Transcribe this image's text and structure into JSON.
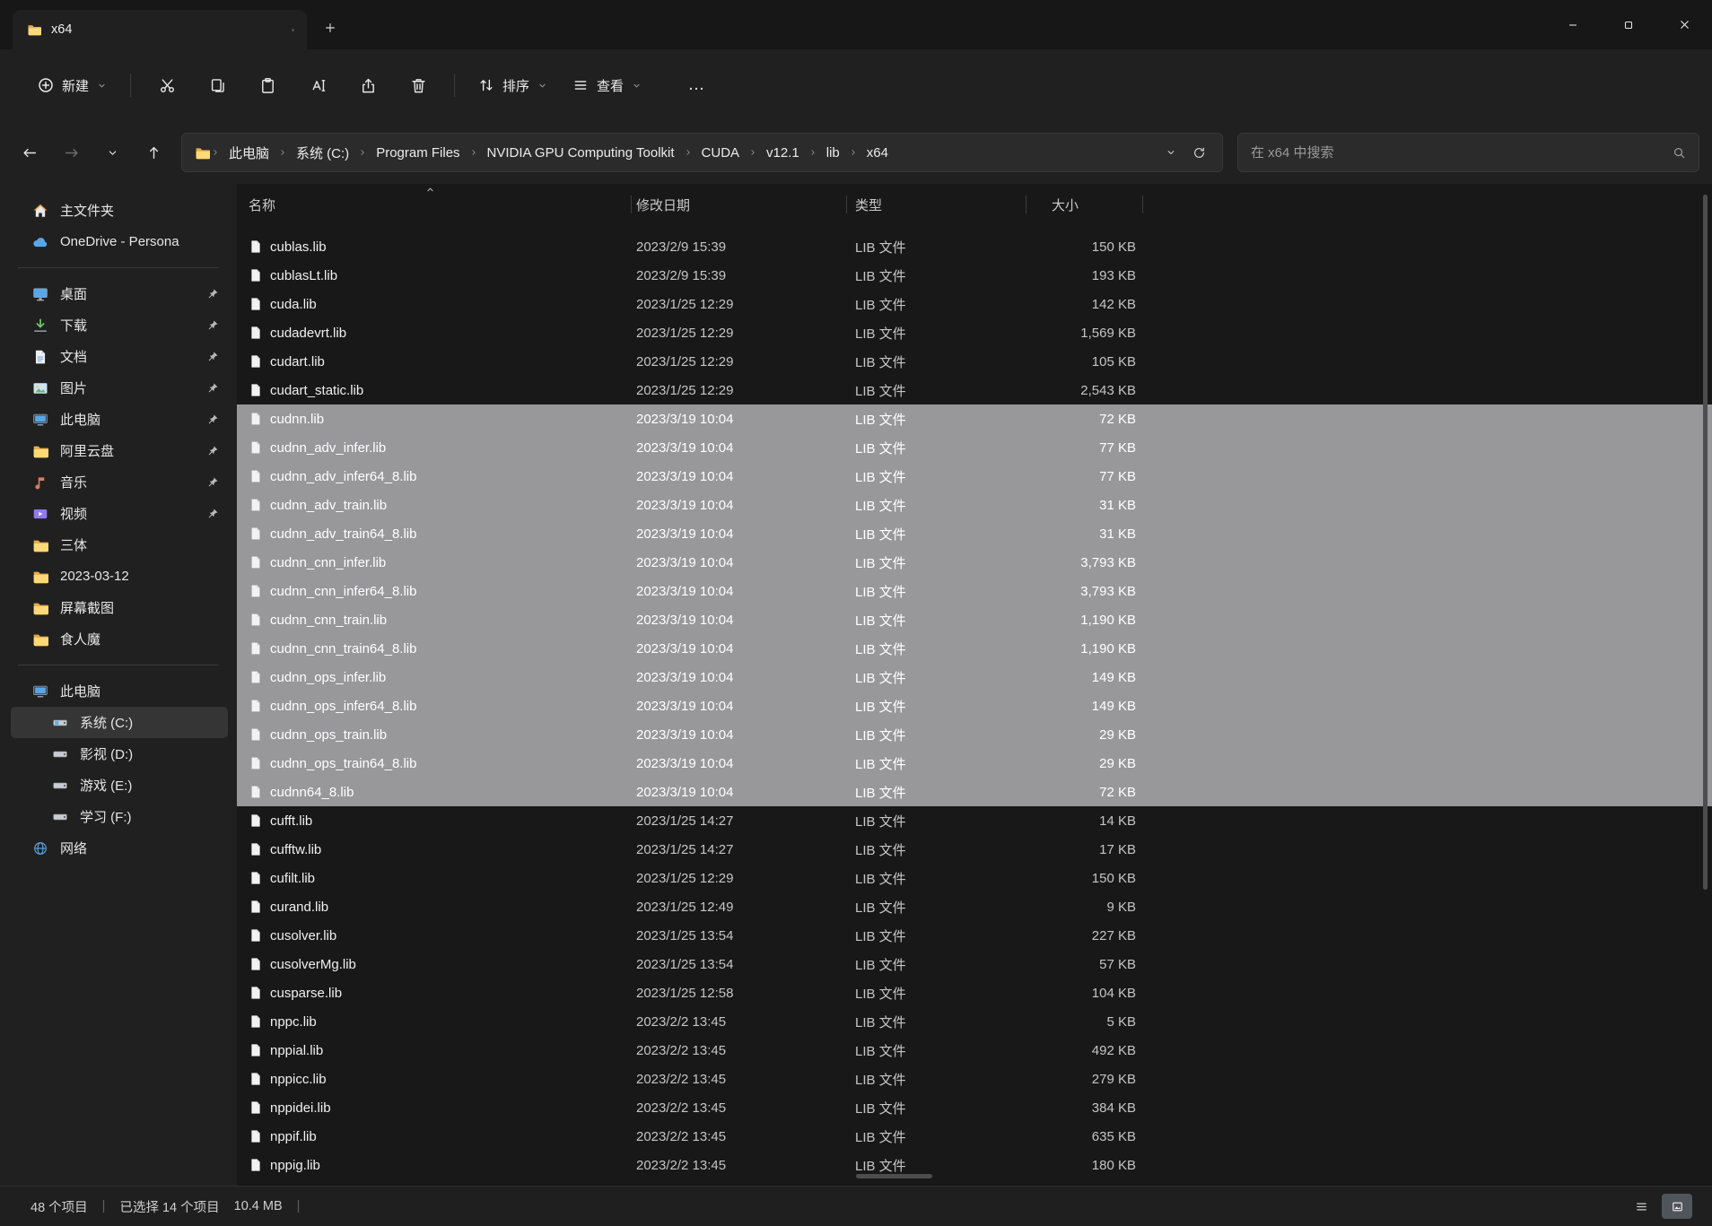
{
  "window": {
    "tab": {
      "title": "x64"
    }
  },
  "toolbar": {
    "new_label": "新建",
    "sort_label": "排序",
    "view_label": "查看",
    "more_label": "…",
    "icon_buttons": [
      {
        "icon": "cut"
      },
      {
        "icon": "copy"
      },
      {
        "icon": "paste"
      },
      {
        "icon": "rename"
      },
      {
        "icon": "share"
      },
      {
        "icon": "trash"
      }
    ]
  },
  "address": {
    "crumbs": [
      {
        "label": "此电脑"
      },
      {
        "label": "系统 (C:)"
      },
      {
        "label": "Program Files"
      },
      {
        "label": "NVIDIA GPU Computing Toolkit"
      },
      {
        "label": "CUDA"
      },
      {
        "label": "v12.1"
      },
      {
        "label": "lib"
      },
      {
        "label": "x64"
      }
    ],
    "search_placeholder": "在 x64 中搜索"
  },
  "sidebar": {
    "top": [
      {
        "label": "主文件夹",
        "icon": "home"
      },
      {
        "label": "OneDrive - Persona",
        "icon": "cloud"
      }
    ],
    "quick": [
      {
        "label": "桌面",
        "icon": "desktop",
        "pinned": true
      },
      {
        "label": "下载",
        "icon": "download",
        "pinned": true
      },
      {
        "label": "文档",
        "icon": "document",
        "pinned": true
      },
      {
        "label": "图片",
        "icon": "picture",
        "pinned": true
      },
      {
        "label": "此电脑",
        "icon": "pc",
        "pinned": true
      },
      {
        "label": "阿里云盘",
        "icon": "folder",
        "pinned": true
      },
      {
        "label": "音乐",
        "icon": "music",
        "pinned": true
      },
      {
        "label": "视频",
        "icon": "video",
        "pinned": true
      },
      {
        "label": "三体",
        "icon": "folder"
      },
      {
        "label": "2023-03-12",
        "icon": "folder"
      },
      {
        "label": "屏幕截图",
        "icon": "folder"
      },
      {
        "label": "食人魔",
        "icon": "folder"
      }
    ],
    "drives": [
      {
        "label": "此电脑",
        "icon": "pc"
      },
      {
        "label": "系统 (C:)",
        "icon": "drive-win",
        "selected": true,
        "indent": true
      },
      {
        "label": "影视 (D:)",
        "icon": "drive",
        "indent": true
      },
      {
        "label": "游戏 (E:)",
        "icon": "drive",
        "indent": true
      },
      {
        "label": "学习 (F:)",
        "icon": "drive",
        "indent": true
      },
      {
        "label": "网络",
        "icon": "network"
      }
    ]
  },
  "filelist": {
    "columns": {
      "name": "名称",
      "date": "修改日期",
      "type": "类型",
      "size": "大小"
    },
    "rows": [
      {
        "name": "cublas.lib",
        "date": "2023/2/9 15:39",
        "type": "LIB 文件",
        "size": "150 KB"
      },
      {
        "name": "cublasLt.lib",
        "date": "2023/2/9 15:39",
        "type": "LIB 文件",
        "size": "193 KB"
      },
      {
        "name": "cuda.lib",
        "date": "2023/1/25 12:29",
        "type": "LIB 文件",
        "size": "142 KB"
      },
      {
        "name": "cudadevrt.lib",
        "date": "2023/1/25 12:29",
        "type": "LIB 文件",
        "size": "1,569 KB"
      },
      {
        "name": "cudart.lib",
        "date": "2023/1/25 12:29",
        "type": "LIB 文件",
        "size": "105 KB"
      },
      {
        "name": "cudart_static.lib",
        "date": "2023/1/25 12:29",
        "type": "LIB 文件",
        "size": "2,543 KB"
      },
      {
        "name": "cudnn.lib",
        "date": "2023/3/19 10:04",
        "type": "LIB 文件",
        "size": "72 KB",
        "selected": true
      },
      {
        "name": "cudnn_adv_infer.lib",
        "date": "2023/3/19 10:04",
        "type": "LIB 文件",
        "size": "77 KB",
        "selected": true
      },
      {
        "name": "cudnn_adv_infer64_8.lib",
        "date": "2023/3/19 10:04",
        "type": "LIB 文件",
        "size": "77 KB",
        "selected": true
      },
      {
        "name": "cudnn_adv_train.lib",
        "date": "2023/3/19 10:04",
        "type": "LIB 文件",
        "size": "31 KB",
        "selected": true
      },
      {
        "name": "cudnn_adv_train64_8.lib",
        "date": "2023/3/19 10:04",
        "type": "LIB 文件",
        "size": "31 KB",
        "selected": true
      },
      {
        "name": "cudnn_cnn_infer.lib",
        "date": "2023/3/19 10:04",
        "type": "LIB 文件",
        "size": "3,793 KB",
        "selected": true
      },
      {
        "name": "cudnn_cnn_infer64_8.lib",
        "date": "2023/3/19 10:04",
        "type": "LIB 文件",
        "size": "3,793 KB",
        "selected": true
      },
      {
        "name": "cudnn_cnn_train.lib",
        "date": "2023/3/19 10:04",
        "type": "LIB 文件",
        "size": "1,190 KB",
        "selected": true
      },
      {
        "name": "cudnn_cnn_train64_8.lib",
        "date": "2023/3/19 10:04",
        "type": "LIB 文件",
        "size": "1,190 KB",
        "selected": true
      },
      {
        "name": "cudnn_ops_infer.lib",
        "date": "2023/3/19 10:04",
        "type": "LIB 文件",
        "size": "149 KB",
        "selected": true
      },
      {
        "name": "cudnn_ops_infer64_8.lib",
        "date": "2023/3/19 10:04",
        "type": "LIB 文件",
        "size": "149 KB",
        "selected": true
      },
      {
        "name": "cudnn_ops_train.lib",
        "date": "2023/3/19 10:04",
        "type": "LIB 文件",
        "size": "29 KB",
        "selected": true
      },
      {
        "name": "cudnn_ops_train64_8.lib",
        "date": "2023/3/19 10:04",
        "type": "LIB 文件",
        "size": "29 KB",
        "selected": true
      },
      {
        "name": "cudnn64_8.lib",
        "date": "2023/3/19 10:04",
        "type": "LIB 文件",
        "size": "72 KB",
        "selected": true
      },
      {
        "name": "cufft.lib",
        "date": "2023/1/25 14:27",
        "type": "LIB 文件",
        "size": "14 KB"
      },
      {
        "name": "cufftw.lib",
        "date": "2023/1/25 14:27",
        "type": "LIB 文件",
        "size": "17 KB"
      },
      {
        "name": "cufilt.lib",
        "date": "2023/1/25 12:29",
        "type": "LIB 文件",
        "size": "150 KB"
      },
      {
        "name": "curand.lib",
        "date": "2023/1/25 12:49",
        "type": "LIB 文件",
        "size": "9 KB"
      },
      {
        "name": "cusolver.lib",
        "date": "2023/1/25 13:54",
        "type": "LIB 文件",
        "size": "227 KB"
      },
      {
        "name": "cusolverMg.lib",
        "date": "2023/1/25 13:54",
        "type": "LIB 文件",
        "size": "57 KB"
      },
      {
        "name": "cusparse.lib",
        "date": "2023/1/25 12:58",
        "type": "LIB 文件",
        "size": "104 KB"
      },
      {
        "name": "nppc.lib",
        "date": "2023/2/2 13:45",
        "type": "LIB 文件",
        "size": "5 KB"
      },
      {
        "name": "nppial.lib",
        "date": "2023/2/2 13:45",
        "type": "LIB 文件",
        "size": "492 KB"
      },
      {
        "name": "nppicc.lib",
        "date": "2023/2/2 13:45",
        "type": "LIB 文件",
        "size": "279 KB"
      },
      {
        "name": "nppidei.lib",
        "date": "2023/2/2 13:45",
        "type": "LIB 文件",
        "size": "384 KB"
      },
      {
        "name": "nppif.lib",
        "date": "2023/2/2 13:45",
        "type": "LIB 文件",
        "size": "635 KB"
      },
      {
        "name": "nppig.lib",
        "date": "2023/2/2 13:45",
        "type": "LIB 文件",
        "size": "180 KB"
      }
    ]
  },
  "statusbar": {
    "items_count": "48 个项目",
    "selected_count": "已选择 14 个项目",
    "selected_size": "10.4 MB",
    "divider": "|"
  }
}
